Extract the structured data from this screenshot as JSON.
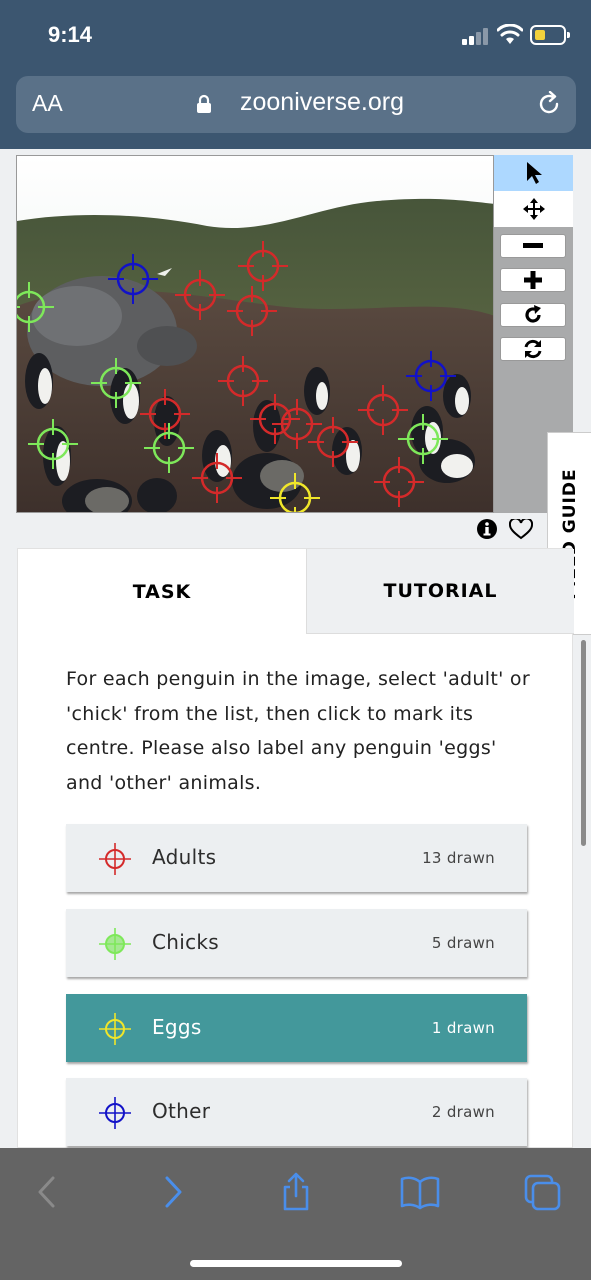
{
  "status_bar": {
    "time": "9:14"
  },
  "address_bar": {
    "text_size_label": "AA",
    "url": "zooniverse.org"
  },
  "subject_viewer": {
    "markers": [
      {
        "type": "other",
        "color": "#1212c8"
      },
      {
        "type": "other",
        "color": "#1212c8"
      },
      {
        "type": "adult",
        "color": "#d42a2a"
      },
      {
        "type": "chick",
        "color": "#7ee85a"
      },
      {
        "type": "egg",
        "color": "#f0e62a"
      }
    ]
  },
  "image_tools": [
    "pointer-icon",
    "move-icon",
    "zoom-out-icon",
    "zoom-in-icon",
    "rotate-icon",
    "reset-icon"
  ],
  "field_guide": {
    "label": "FIELD GUIDE"
  },
  "tabs": {
    "task": "TASK",
    "tutorial": "TUTORIAL"
  },
  "instructions": "For each penguin in the image, select 'adult' or 'chick' from the list, then click to mark its centre. Please also label any penguin 'eggs' and 'other' animals.",
  "tools": [
    {
      "label": "Adults",
      "count": "13 drawn",
      "color": "#d42a2a"
    },
    {
      "label": "Chicks",
      "count": "5 drawn",
      "color": "#7ee85a"
    },
    {
      "label": "Eggs",
      "count": "1 drawn",
      "color": "#f0e62a"
    },
    {
      "label": "Other",
      "count": "2 drawn",
      "color": "#1212c8"
    }
  ],
  "colors": {
    "status_bg": "#3c5670",
    "selected_tool": "#43989b",
    "bottom_bar": "#646464",
    "link_blue": "#4a8eea"
  }
}
